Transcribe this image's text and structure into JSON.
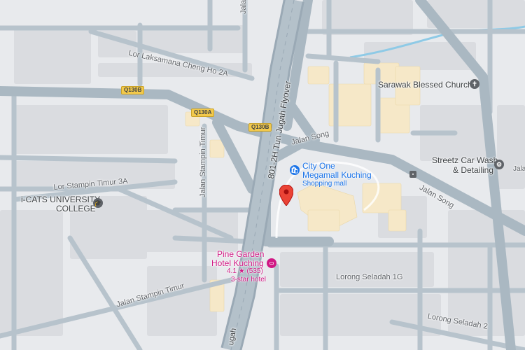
{
  "map": {
    "colors": {
      "background": "#e8eaed",
      "block": "#dadce0",
      "road": "#aab8c2",
      "road_edge": "#9fb0bd",
      "highway": "#9aa9b5",
      "building_beige": "#f6e8c8",
      "water": "#8ecae6",
      "pin": "#ea4335",
      "mall_blue": "#1a73e8",
      "hotel_pink": "#d01884",
      "shield": "#f2c94c"
    },
    "street_labels": {
      "jalan_jelu": "Jalan Jelu",
      "lor_laksamana": "Lor Laksamana Cheng Ho 2A",
      "flyover": "801-2H Tun Jugah Flyover",
      "jalan_song_1": "Jalan Song",
      "jalan_song_2": "Jalan Song",
      "jalan_stampin_timur_1": "Jalan Stampin Timur",
      "lor_stampin_timur_3a": "Lor Stampin Timur 3A",
      "jalan_stampin_timur_2": "Jalan Stampin Timur",
      "lorong_seladah_1g": "Lorong Seladah 1G",
      "lorong_seladah_2": "Lorong Seladah 2",
      "jugah_bottom": "ugah"
    },
    "route_shields": {
      "q130b_1": "Q130B",
      "q130a": "Q130A",
      "q130b_2": "Q130B"
    },
    "pois": {
      "church": {
        "name": "Sarawak Blessed Church",
        "icon": "church-icon"
      },
      "mall": {
        "line1": "City One",
        "line2": "Megamall Kuching",
        "category": "Shopping mall",
        "icon": "shopping-bag-icon"
      },
      "car_wash": {
        "line1": "Streetz Car Wash",
        "line2": "& Detailing",
        "icon": "car-wash-icon"
      },
      "university": {
        "line1": "i-CATS UNIVERSITY",
        "line2": "COLLEGE",
        "icon": "graduation-cap-icon"
      },
      "hotel": {
        "line1": "Pine Garden",
        "line2": "Hotel Kuching",
        "rating": "4.1",
        "star": "★",
        "reviews": "(535)",
        "class": "3-star hotel",
        "icon": "bed-icon"
      },
      "bus_stop": {
        "label": "Jala",
        "icon": "bus-stop-icon"
      }
    },
    "marker": {
      "icon": "location-pin-icon"
    }
  }
}
